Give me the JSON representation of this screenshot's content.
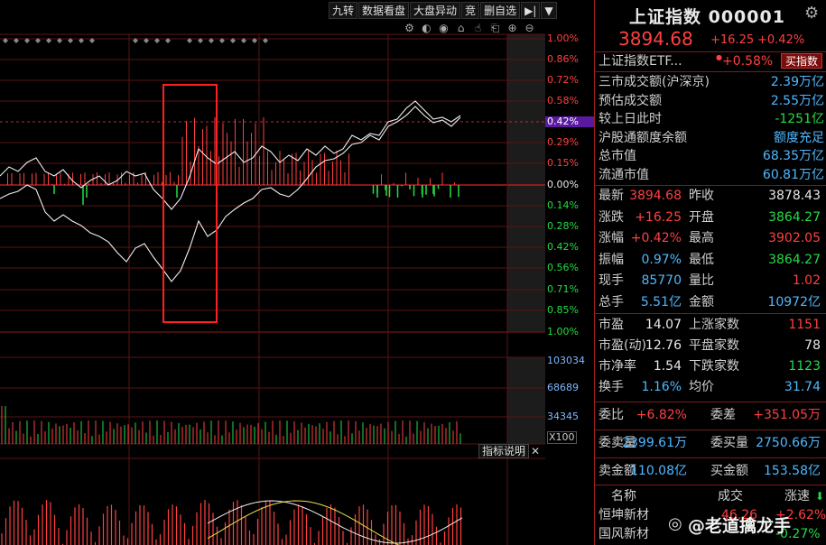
{
  "toolbar": {
    "buttons": [
      "九转",
      "数据看盘",
      "大盘异动",
      "竞",
      "删自选"
    ],
    "nav_icon": "▶|",
    "dropdown_icon": "▼"
  },
  "iconbar": [
    "⚙",
    "◐",
    "◉",
    "⌂",
    "☝",
    "⎗",
    "⊕",
    "⊖"
  ],
  "chart_data": {
    "type": "line",
    "pct_axis": [
      "1.00%",
      "0.86%",
      "0.72%",
      "0.58%",
      "0.42%",
      "0.29%",
      "0.15%",
      "0.00%",
      "0.14%",
      "0.28%",
      "0.42%",
      "0.56%",
      "0.71%",
      "0.85%",
      "1.00%"
    ],
    "pct_axis_colors": [
      "red",
      "red",
      "red",
      "red",
      "red",
      "red",
      "red",
      "white",
      "green",
      "green",
      "green",
      "green",
      "green",
      "green",
      "green"
    ],
    "current_pct_label": "0.42%",
    "volume_axis": [
      "103034",
      "68689",
      "34345"
    ],
    "x100_label": "X100",
    "indicator_button": "指标说明",
    "indicator_close": "✕"
  },
  "quote": {
    "title": "上证指数 000001",
    "price": "3894.68",
    "change": "+16.25",
    "change_pct": "+0.42%",
    "etf_name": "上证指数ETF...",
    "etf_pct": "+0.58%",
    "buy_button": "买指数",
    "stats": [
      {
        "label": "三市成交额(沪深京)",
        "value": "2.39万亿",
        "color": "cyan"
      },
      {
        "label": "预估成交额",
        "value": "2.55万亿",
        "color": "cyan"
      },
      {
        "label": "较上日此时",
        "value": "-1251亿",
        "color": "green"
      },
      {
        "label": "沪股通额度余额",
        "value": "额度充足",
        "color": "cyan"
      },
      {
        "label": "总市值",
        "value": "68.35万亿",
        "color": "cyan"
      },
      {
        "label": "流通市值",
        "value": "60.81万亿",
        "color": "cyan"
      }
    ],
    "grid1": [
      [
        "最新",
        "3894.68",
        "red",
        "昨收",
        "3878.43",
        "white"
      ],
      [
        "涨跌",
        "+16.25",
        "red",
        "开盘",
        "3864.27",
        "green"
      ],
      [
        "涨幅",
        "+0.42%",
        "red",
        "最高",
        "3902.05",
        "red"
      ],
      [
        "振幅",
        "0.97%",
        "cyan",
        "最低",
        "3864.27",
        "green"
      ],
      [
        "现手",
        "85770",
        "cyan",
        "量比",
        "1.02",
        "red"
      ],
      [
        "总手",
        "5.51亿",
        "cyan",
        "金额",
        "10972亿",
        "cyan"
      ]
    ],
    "grid2": [
      [
        "市盈",
        "14.07",
        "white",
        "上涨家数",
        "1151",
        "red"
      ],
      [
        "市盈(动)",
        "12.76",
        "white",
        "平盘家数",
        "78",
        "white"
      ],
      [
        "市净率",
        "1.54",
        "white",
        "下跌家数",
        "1123",
        "green"
      ],
      [
        "换手",
        "1.16%",
        "cyan",
        "均价",
        "31.74",
        "cyan"
      ]
    ],
    "grid3": [
      [
        "委比",
        "+6.82%",
        "red",
        "委差",
        "+351.05万",
        "red"
      ]
    ],
    "grid4": [
      [
        "委卖量",
        "2399.61万",
        "cyan",
        "委买量",
        "2750.66万",
        "cyan"
      ]
    ],
    "grid5": [
      [
        "卖金额",
        "110.08亿",
        "cyan",
        "买金额",
        "153.58亿",
        "cyan"
      ]
    ],
    "list_header": [
      "名称",
      "成交",
      "涨速"
    ],
    "list_rows": [
      [
        "恒坤新材",
        "46.26",
        "+2.62%"
      ],
      [
        "国风新材",
        "",
        "-0.27%"
      ]
    ]
  },
  "watermark": "@老道擒龙手"
}
